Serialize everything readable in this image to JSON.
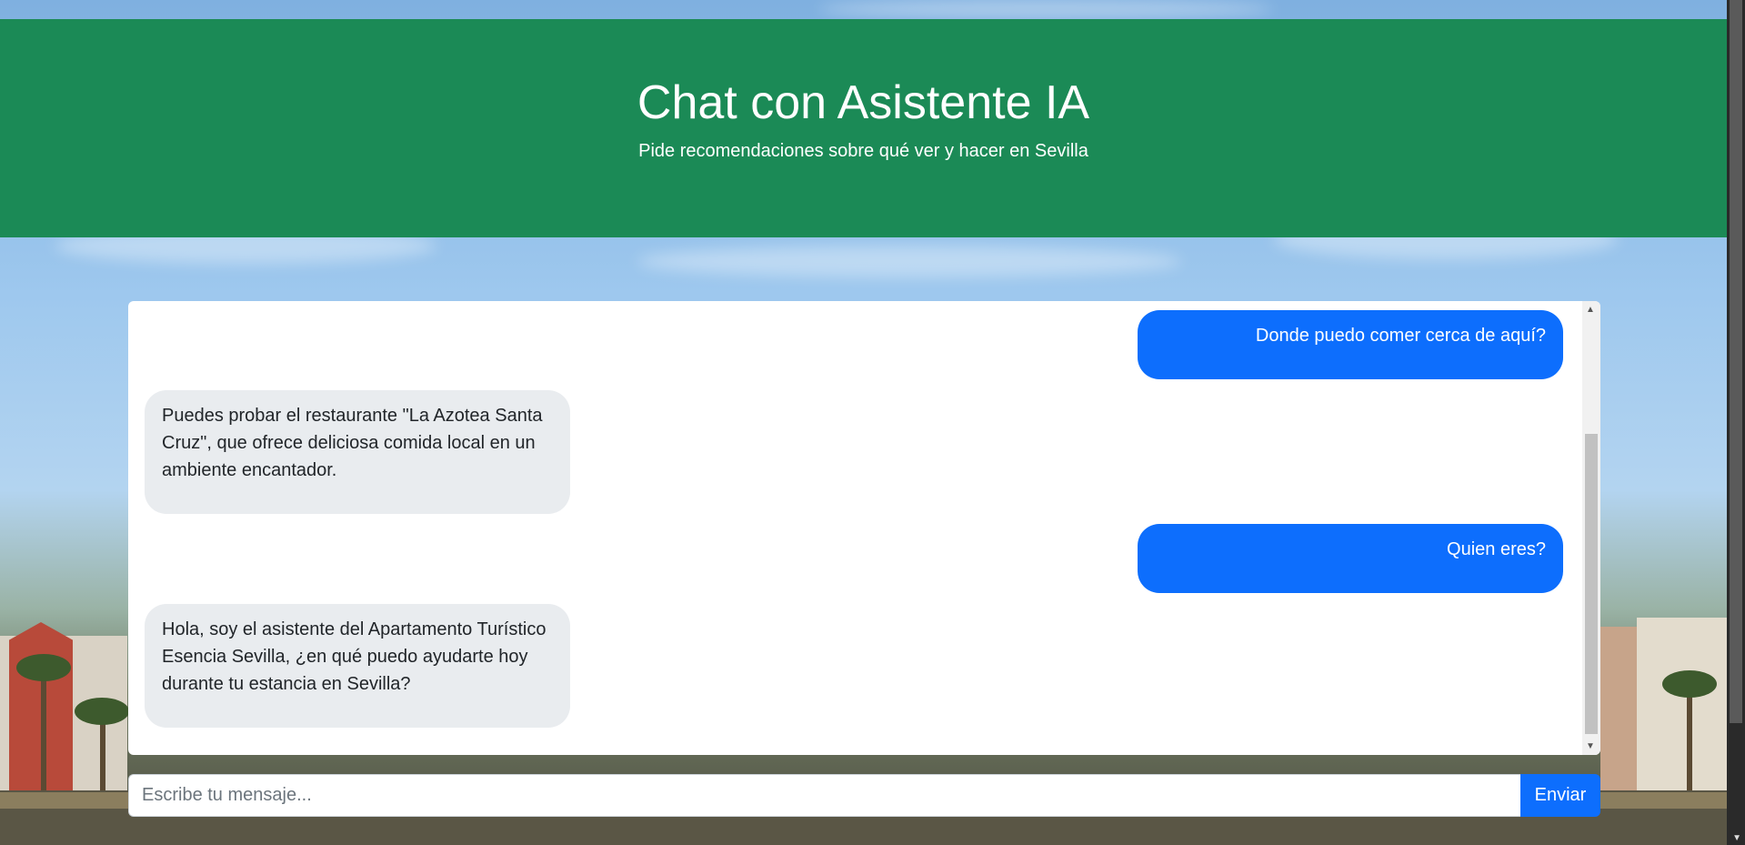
{
  "header": {
    "title": "Chat con Asistente IA",
    "subtitle": "Pide recomendaciones sobre qué ver y hacer en Sevilla"
  },
  "messages": [
    {
      "role": "user",
      "text": "Donde puedo comer cerca de aquí?"
    },
    {
      "role": "bot",
      "text": "Puedes probar el restaurante \"La Azotea Santa Cruz\", que ofrece deliciosa comida local en un ambiente encantador."
    },
    {
      "role": "user",
      "text": "Quien eres?"
    },
    {
      "role": "bot",
      "text": "Hola, soy el asistente del Apartamento Turístico Esencia Sevilla, ¿en qué puedo ayudarte hoy durante tu estancia en Sevilla?"
    }
  ],
  "input": {
    "placeholder": "Escribe tu mensaje...",
    "value": ""
  },
  "send_button": {
    "label": "Enviar"
  },
  "colors": {
    "header_bg": "#1b8a56",
    "user_bubble": "#0d6efd",
    "bot_bubble": "#e9ecef",
    "button": "#0d6efd"
  }
}
